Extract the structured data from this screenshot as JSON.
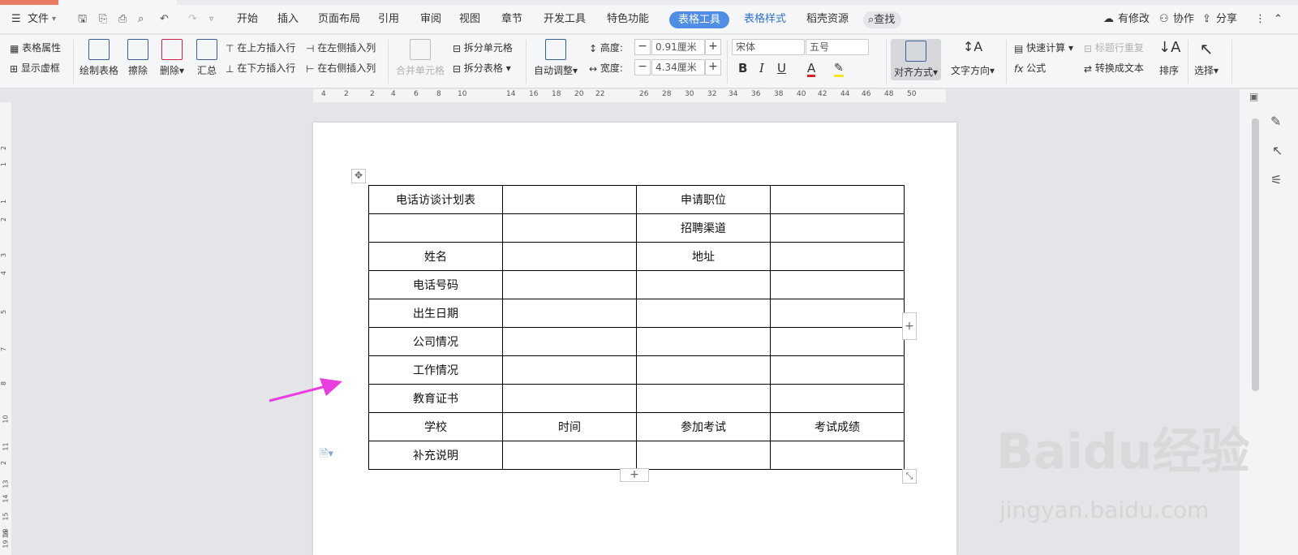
{
  "menubar": {
    "file": "文件",
    "tabs": [
      "开始",
      "插入",
      "页面布局",
      "引用",
      "审阅",
      "视图",
      "章节",
      "开发工具",
      "特色功能"
    ],
    "active_tab": "表格工具",
    "tabs_after": [
      "表格样式",
      "稻壳资源"
    ],
    "search": "查找",
    "right": [
      "有修改",
      "协作",
      "分享"
    ]
  },
  "ribbon": {
    "table_props": "表格属性",
    "show_gridlines": "显示虚框",
    "draw_table": "绘制表格",
    "erase": "擦除",
    "delete": "删除",
    "summary": "汇总",
    "insert_row_above": "在上方插入行",
    "insert_row_below": "在下方插入行",
    "insert_col_left": "在左侧插入列",
    "insert_col_right": "在右侧插入列",
    "merge_cells": "合并单元格",
    "split_cells": "拆分单元格",
    "split_table": "拆分表格",
    "auto_adjust": "自动调整",
    "height_label": "高度:",
    "height_value": "0.91厘米",
    "width_label": "宽度:",
    "width_value": "4.34厘米",
    "font_name": "宋体",
    "font_size": "五号",
    "align": "对齐方式",
    "text_direction": "文字方向",
    "quick_calc": "快速计算",
    "formula": "公式",
    "repeat_header": "标题行重复",
    "convert_to_text": "转换成文本",
    "sort": "排序",
    "select": "选择"
  },
  "ruler": {
    "top": [
      "4",
      "2",
      "2",
      "4",
      "6",
      "8",
      "10",
      "14",
      "16",
      "18",
      "20",
      "22",
      "26",
      "28",
      "30",
      "32",
      "34",
      "36",
      "38",
      "40",
      "42",
      "44",
      "46",
      "48",
      "50"
    ],
    "left": [
      "2",
      "1",
      "1",
      "2",
      "3",
      "4",
      "5",
      "7",
      "8",
      "10",
      "11",
      "2",
      "13",
      "14",
      "15",
      "16",
      "17",
      "18",
      "19"
    ]
  },
  "table": {
    "rows": [
      [
        "电话访谈计划表",
        "",
        "申请职位",
        ""
      ],
      [
        "",
        "",
        "招聘渠道",
        ""
      ],
      [
        "姓名",
        "",
        "地址",
        ""
      ],
      [
        "电话号码",
        "",
        "",
        ""
      ],
      [
        "出生日期",
        "",
        "",
        ""
      ],
      [
        "公司情况",
        "",
        "",
        ""
      ],
      [
        "工作情况",
        "",
        "",
        ""
      ],
      [
        "教育证书",
        "",
        "",
        ""
      ],
      [
        "学校",
        "时间",
        "参加考试",
        "考试成绩"
      ],
      [
        "补充说明",
        "",
        "",
        ""
      ]
    ]
  },
  "watermark": {
    "brand": "Baidu经验",
    "url": "jingyan.baidu.com"
  },
  "colors": {
    "accent": "#4f8de6",
    "arrow": "#e83ee0"
  }
}
